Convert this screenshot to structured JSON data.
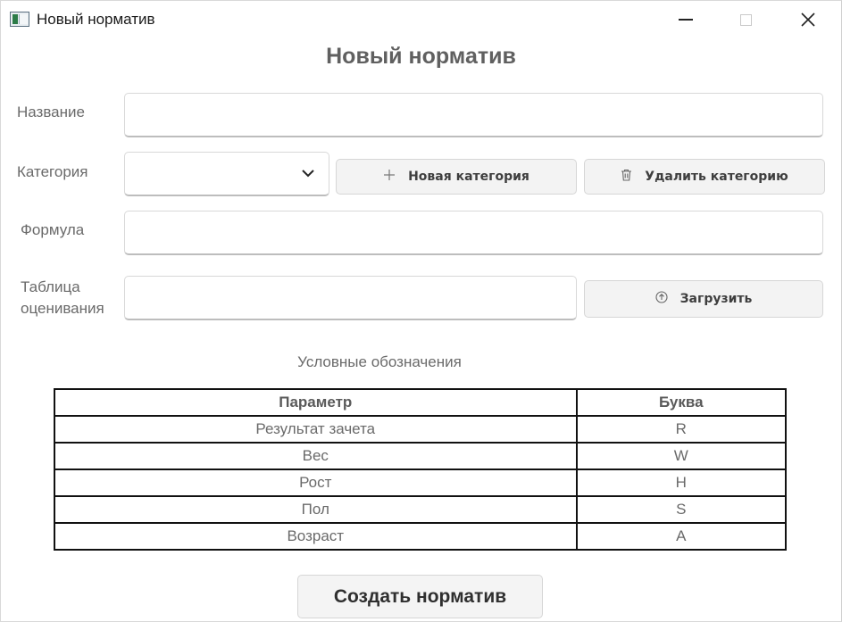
{
  "window": {
    "title": "Новый норматив"
  },
  "form": {
    "heading": "Новый норматив",
    "name_label": "Название",
    "name_value": "",
    "category_label": "Категория",
    "category_value": "",
    "new_category_label": "Новая категория",
    "delete_category_label": "Удалить категорию",
    "formula_label": "Формула",
    "formula_value": "",
    "table_label_line1": "Таблица",
    "table_label_line2": "оценивания",
    "table_value": "",
    "upload_label": "Загрузить",
    "legend_caption": "Условные обозначения",
    "legend": {
      "headers": [
        "Параметр",
        "Буква"
      ],
      "rows": [
        [
          "Результат зачета",
          "R"
        ],
        [
          "Вес",
          "W"
        ],
        [
          "Рост",
          "H"
        ],
        [
          "Пол",
          "S"
        ],
        [
          "Возраст",
          "A"
        ]
      ]
    },
    "create_label": "Создать норматив"
  },
  "icons": {
    "plus": "plus-icon",
    "trash": "trash-icon",
    "upload": "upload-icon",
    "chevron": "chevron-down-icon"
  }
}
